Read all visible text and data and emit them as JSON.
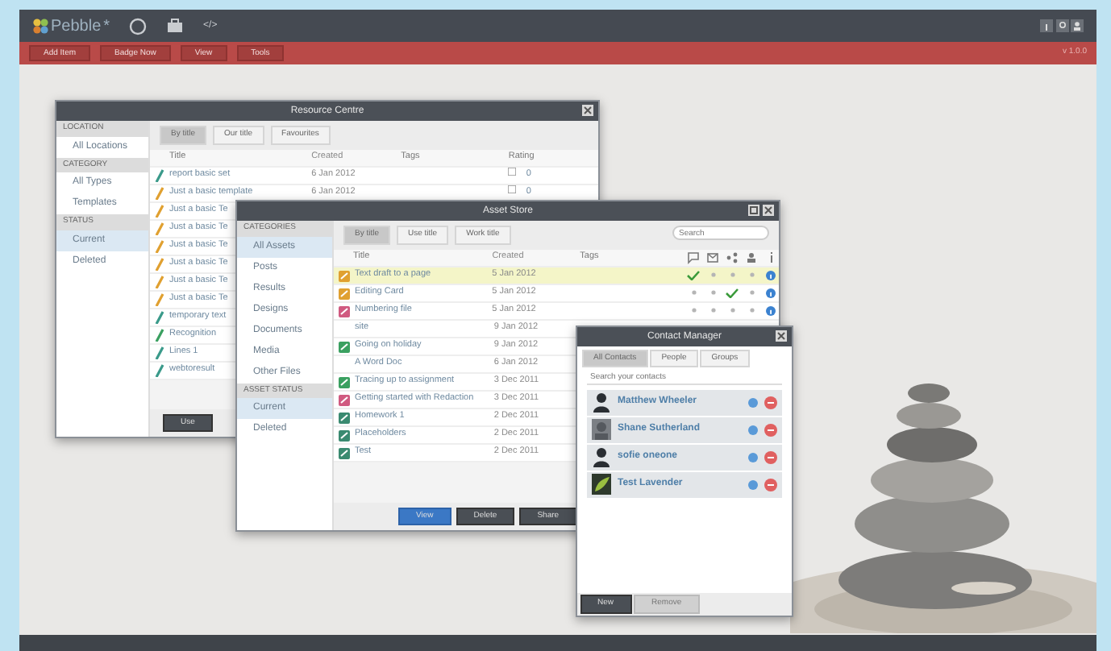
{
  "app": {
    "title": "Pebble",
    "title_mark": "*",
    "code_icon": "</>"
  },
  "toolbar": {
    "buttons": [
      "Add Item",
      "Badge Now",
      "View",
      "Tools"
    ],
    "version": "v 1.0.0"
  },
  "resource_centre": {
    "title": "Resource Centre",
    "sidebar": [
      {
        "heading": "LOCATION",
        "items": [
          {
            "label": "All Locations",
            "selected": false
          }
        ]
      },
      {
        "heading": "CATEGORY",
        "items": [
          {
            "label": "All Types",
            "selected": false
          },
          {
            "label": "Templates",
            "selected": false
          }
        ]
      },
      {
        "heading": "STATUS",
        "items": [
          {
            "label": "Current",
            "selected": true
          },
          {
            "label": "Deleted",
            "selected": false
          }
        ]
      }
    ],
    "tabs": [
      {
        "label": "By title",
        "selected": true
      },
      {
        "label": "Our title",
        "selected": false
      },
      {
        "label": "Favourites",
        "selected": false
      }
    ],
    "columns": [
      "Title",
      "Created",
      "Tags",
      "Rating"
    ],
    "rows": [
      {
        "title": "report basic set",
        "created": "6 Jan 2012",
        "rating": "0",
        "color": "#3a9a8a"
      },
      {
        "title": "Just a basic template",
        "created": "6 Jan 2012",
        "rating": "0",
        "color": "#e0a030"
      },
      {
        "title": "Just a basic Te",
        "color": "#e0a030"
      },
      {
        "title": "Just a basic Te",
        "color": "#e0a030"
      },
      {
        "title": "Just a basic Te",
        "color": "#e0a030"
      },
      {
        "title": "Just a basic Te",
        "color": "#e0a030"
      },
      {
        "title": "Just a basic Te",
        "color": "#e0a030"
      },
      {
        "title": "Just a basic Te",
        "color": "#e0a030"
      },
      {
        "title": "temporary text",
        "color": "#3a9a8a"
      },
      {
        "title": "Recognition",
        "color": "#3aa060"
      },
      {
        "title": "Lines 1",
        "color": "#3a9a8a"
      },
      {
        "title": "webtoresult",
        "color": "#3a9a8a"
      }
    ],
    "button": "Use"
  },
  "asset_store": {
    "title": "Asset Store",
    "sidebar": [
      {
        "heading": "CATEGORIES",
        "items": [
          {
            "label": "All Assets",
            "selected": true
          },
          {
            "label": "Posts",
            "selected": false
          },
          {
            "label": "Results",
            "selected": false
          },
          {
            "label": "Designs",
            "selected": false
          },
          {
            "label": "Documents",
            "selected": false
          },
          {
            "label": "Media",
            "selected": false
          },
          {
            "label": "Other Files",
            "selected": false
          }
        ]
      },
      {
        "heading": "ASSET STATUS",
        "items": [
          {
            "label": "Current",
            "selected": true
          },
          {
            "label": "Deleted",
            "selected": false
          }
        ]
      }
    ],
    "tabs": [
      {
        "label": "By title",
        "selected": true
      },
      {
        "label": "Use title",
        "selected": false
      },
      {
        "label": "Work title",
        "selected": false
      }
    ],
    "search": {
      "placeholder": "Search"
    },
    "columns": [
      "Title",
      "Created",
      "Tags"
    ],
    "rows": [
      {
        "title": "Text draft to a page",
        "created": "5 Jan 2012",
        "selected": true,
        "color": "#e0a030",
        "checks": [
          true,
          false,
          false,
          false
        ]
      },
      {
        "title": "Editing Card",
        "created": "5 Jan 2012",
        "selected": false,
        "color": "#e0a030",
        "checks": [
          false,
          false,
          true,
          false
        ]
      },
      {
        "title": "Numbering file",
        "created": "5 Jan 2012",
        "selected": false,
        "color": "#d05a80",
        "checks": [
          false,
          false,
          false,
          false
        ]
      },
      {
        "title": "site",
        "created": "9 Jan 2012",
        "selected": false
      },
      {
        "title": "Going on holiday",
        "created": "9 Jan 2012",
        "selected": false,
        "color": "#3aa060"
      },
      {
        "title": "A Word Doc",
        "created": "6 Jan 2012",
        "selected": false
      },
      {
        "title": "Tracing up to assignment",
        "created": "3 Dec 2011",
        "selected": false,
        "color": "#3aa060"
      },
      {
        "title": "Getting started with Redaction",
        "created": "3 Dec 2011",
        "selected": false,
        "color": "#d05a80"
      },
      {
        "title": "Homework 1",
        "created": "2 Dec 2011",
        "selected": false,
        "color": "#3a8a70"
      },
      {
        "title": "Placeholders",
        "created": "2 Dec 2011",
        "selected": false,
        "color": "#3a8a70"
      },
      {
        "title": "Test",
        "created": "2 Dec 2011",
        "selected": false,
        "color": "#3a8a70"
      }
    ],
    "buttons": [
      {
        "label": "View",
        "kind": "primary"
      },
      {
        "label": "Delete",
        "kind": "dark"
      },
      {
        "label": "Share",
        "kind": "dark"
      }
    ]
  },
  "contact_manager": {
    "title": "Contact Manager",
    "tabs": [
      {
        "label": "All Contacts",
        "selected": true
      },
      {
        "label": "People",
        "selected": false
      },
      {
        "label": "Groups",
        "selected": false
      }
    ],
    "search": {
      "placeholder": "Search your contacts"
    },
    "contacts": [
      {
        "name": "Matthew Wheeler",
        "kind": "silhouette"
      },
      {
        "name": "Shane Sutherland"
      },
      {
        "name": "sofie oneone",
        "kind": "silhouette"
      },
      {
        "name": "Test Lavender",
        "kind": "logo"
      }
    ],
    "buttons": [
      {
        "label": "New",
        "disabled": false
      },
      {
        "label": "Remove",
        "disabled": true
      }
    ]
  }
}
